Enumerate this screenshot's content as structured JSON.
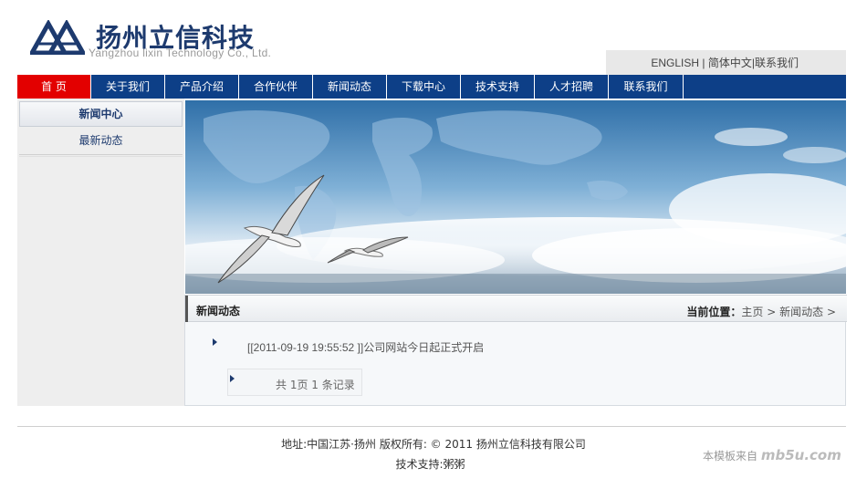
{
  "header": {
    "logo_cn": "扬州立信科技",
    "logo_en": "Yangzhou lixin Technology Co., Ltd.",
    "top_links": [
      "ENGLISH",
      "简体中文",
      "联系我们"
    ]
  },
  "nav": {
    "items": [
      "首  页",
      "关于我们",
      "产品介绍",
      "合作伙伴",
      "新闻动态",
      "下载中心",
      "技术支持",
      "人才招聘",
      "联系我们"
    ],
    "active_color": "#e30000",
    "bar_color": "#0d3f87"
  },
  "sidebar": {
    "title": "新闻中心",
    "items": [
      "最新动态"
    ]
  },
  "content": {
    "title": "新闻动态",
    "location_label": "当前位置：",
    "crumbs": [
      "主页",
      "新闻动态"
    ],
    "news": [
      {
        "text": "[[2011-09-19 19:55:52 ]]公司网站今日起正式开启"
      }
    ],
    "pager": "共  1页 1 条记录"
  },
  "footer": {
    "line1": "地址:中国江苏·扬州  版权所有: © 2011 扬州立信科技有限公司",
    "line2": "技术支持:粥粥"
  },
  "watermark": {
    "prefix": "本模板来自",
    "brand": "mb5u.com"
  }
}
